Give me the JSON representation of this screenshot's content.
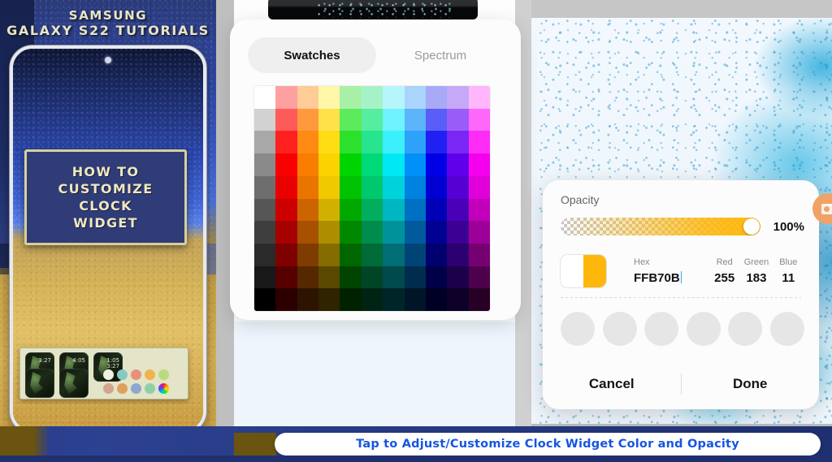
{
  "promo": {
    "brand_line1": "SAMSUNG",
    "brand_line2": "GALAXY S22 TUTORIALS",
    "title_line1": "HOW TO",
    "title_line2": "CUSTOMIZE",
    "title_line3": "CLOCK",
    "title_line4": "WIDGET"
  },
  "caption": {
    "text": "Tap to Adjust/Customize Clock Widget Color and Opacity",
    "color": "#1656e0"
  },
  "dialog": {
    "tabs": [
      {
        "label": "Swatches",
        "active": true
      },
      {
        "label": "Spectrum",
        "active": false
      }
    ],
    "swatch_grid": {
      "columns": 11,
      "rows": 10,
      "colors": [
        [
          "#ffffff",
          "#ffa0a0",
          "#ffcb96",
          "#fff6a8",
          "#a8f0a8",
          "#a6f2c8",
          "#b6f6fb",
          "#a9d4fb",
          "#a8aaf8",
          "#c5a8f8",
          "#ffb6fb"
        ],
        [
          "#d2d2d2",
          "#ff5a5a",
          "#ff9a3c",
          "#ffe14a",
          "#5ceb5c",
          "#55eda0",
          "#6ef2fb",
          "#5cb4fb",
          "#5a5df8",
          "#9a5cf8",
          "#ff66fb"
        ],
        [
          "#a8a8a8",
          "#ff2020",
          "#ff8a14",
          "#ffdc14",
          "#2ee02e",
          "#26e58e",
          "#3bf0fb",
          "#2ea2fb",
          "#2020f2",
          "#7a26f5",
          "#ff2cf7"
        ],
        [
          "#8a8a8a",
          "#fa0000",
          "#f97d00",
          "#fbd400",
          "#00d400",
          "#00d978",
          "#00e8f4",
          "#0090f7",
          "#0000e6",
          "#6000ea",
          "#f400ee"
        ],
        [
          "#6e6e6e",
          "#ea0000",
          "#ea7400",
          "#f0c900",
          "#00c200",
          "#00c86c",
          "#00d2dc",
          "#0082e0",
          "#0000d2",
          "#5600d4",
          "#e000da"
        ],
        [
          "#565656",
          "#cc0000",
          "#cc6400",
          "#d2b000",
          "#00a800",
          "#00ae5e",
          "#00b6c0",
          "#0070c2",
          "#0000b6",
          "#4a00b8",
          "#c200bc"
        ],
        [
          "#3e3e3e",
          "#a60000",
          "#a65000",
          "#ac8e00",
          "#008800",
          "#008c4c",
          "#00929a",
          "#005a9c",
          "#000092",
          "#3c0094",
          "#9c0098"
        ],
        [
          "#2a2a2a",
          "#7e0000",
          "#7e3c00",
          "#846c00",
          "#006600",
          "#006a39",
          "#006e74",
          "#004476",
          "#00006e",
          "#2c0070",
          "#760072"
        ],
        [
          "#181818",
          "#560000",
          "#562800",
          "#5a4800",
          "#004400",
          "#004626",
          "#00494c",
          "#002c4e",
          "#000048",
          "#1c004a",
          "#4e004c"
        ],
        [
          "#000000",
          "#2c0000",
          "#2c1400",
          "#2e2400",
          "#002200",
          "#002413",
          "#002528",
          "#001628",
          "#000024",
          "#0e0026",
          "#280026"
        ]
      ]
    }
  },
  "panel": {
    "opacity": {
      "label": "Opacity",
      "value": "100%",
      "percent": 100
    },
    "color": {
      "hex_caption": "Hex",
      "hex_value": "FFB70B",
      "red_caption": "Red",
      "red_value": "255",
      "green_caption": "Green",
      "green_value": "183",
      "blue_caption": "Blue",
      "blue_value": "11",
      "preview_left": "#ffffff",
      "preview_right": "#ffb70b"
    },
    "recent_colors": [
      "#e6e6e6",
      "#e6e6e6",
      "#e6e6e6",
      "#e6e6e6",
      "#e6e6e6",
      "#e6e6e6"
    ],
    "cancel_label": "Cancel",
    "done_label": "Done"
  },
  "widget_sheet": {
    "thumb_times": [
      "3:27",
      "4:05",
      "1:05\n3:27",
      "",
      ""
    ],
    "color_dots_row1": [
      "#f1efe2",
      "#86c9c2",
      "#e8917a",
      "#f0b44e",
      "#bada7f"
    ],
    "color_dots_row2": [
      "#d3a58d",
      "#e0a05c",
      "#8fa6cf",
      "#8fd0a8",
      "wheel"
    ]
  }
}
